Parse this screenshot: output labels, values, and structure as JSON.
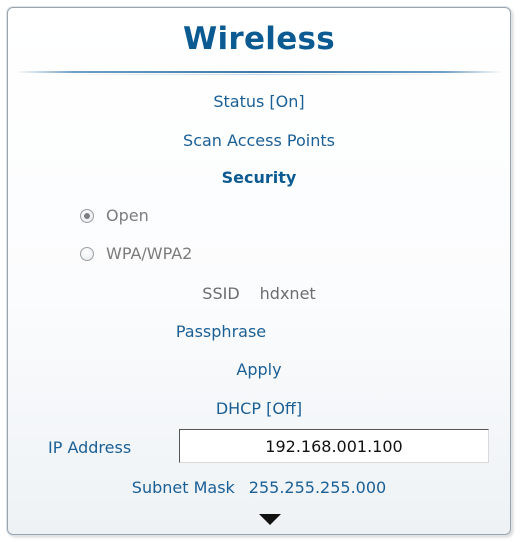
{
  "title": "Wireless",
  "menu": {
    "status": "Status [On]",
    "scan": "Scan Access Points",
    "security": "Security",
    "passphrase": "Passphrase",
    "apply": "Apply",
    "dhcp": "DHCP [Off]"
  },
  "security_options": [
    {
      "label": "Open",
      "selected": true
    },
    {
      "label": "WPA/WPA2",
      "selected": false
    }
  ],
  "ssid": {
    "label": "SSID",
    "value": "hdxnet"
  },
  "ip_address": {
    "label": "IP Address",
    "value": "192.168.001.100"
  },
  "subnet_mask": {
    "label": "Subnet Mask",
    "value": "255.255.255.000"
  },
  "scroll_icon": "down-triangle-icon",
  "colors": {
    "accent": "#0b5a92",
    "link": "#1a5f95",
    "disabled": "#7c7c7c"
  }
}
